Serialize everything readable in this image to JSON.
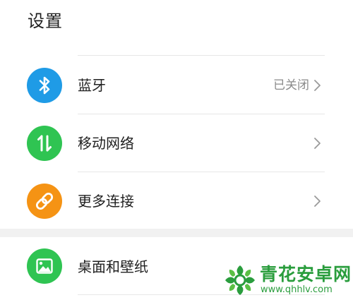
{
  "header": {
    "title": "设置"
  },
  "settings": {
    "items": [
      {
        "label": "蓝牙",
        "value": "已关闭",
        "icon": "bluetooth-icon",
        "icon_color": "#1f9be6"
      },
      {
        "label": "移动网络",
        "value": "",
        "icon": "mobile-data-icon",
        "icon_color": "#2fc452"
      },
      {
        "label": "更多连接",
        "value": "",
        "icon": "link-icon",
        "icon_color": "#f59314"
      }
    ],
    "display_items": [
      {
        "label": "桌面和壁纸",
        "icon": "image-icon",
        "icon_color": "#2fc452"
      }
    ]
  },
  "watermark": {
    "title": "青花安卓网",
    "url": "www.qhhlv.com"
  }
}
